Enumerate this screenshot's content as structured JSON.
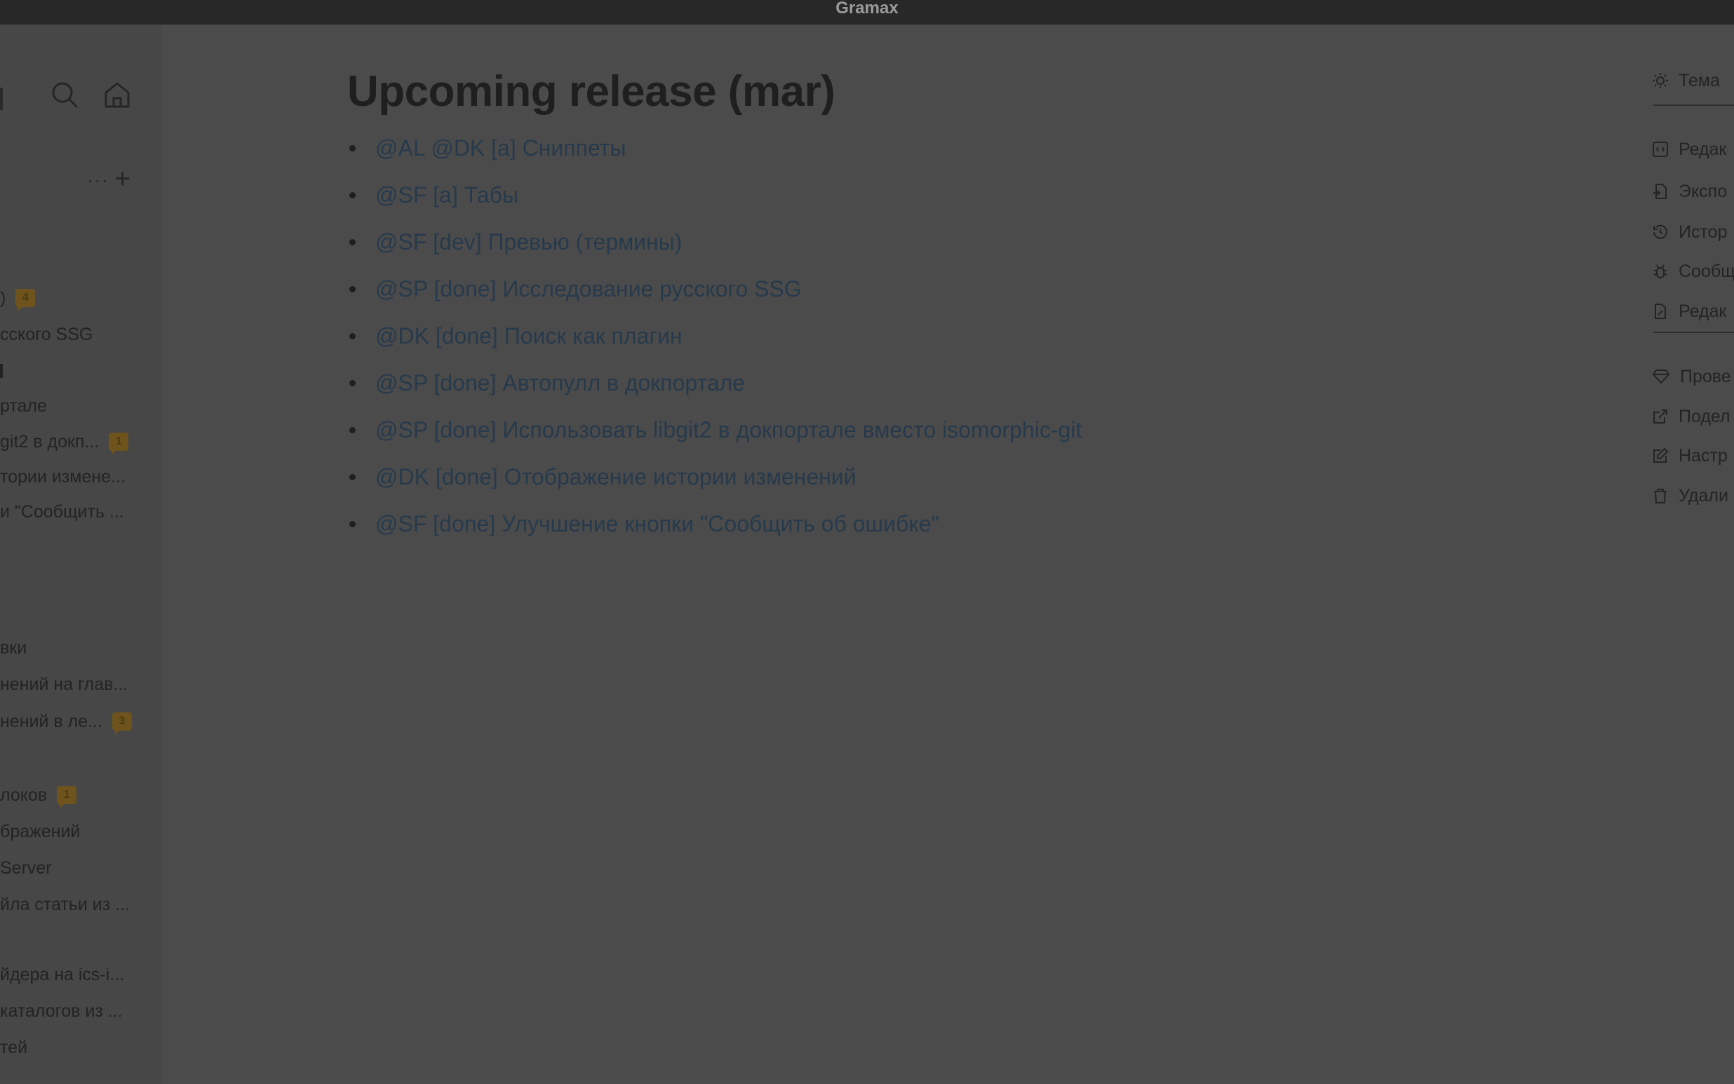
{
  "app": {
    "title": "Gramax"
  },
  "sidebar": {
    "items": [
      {
        "label": ")",
        "badge": "4"
      },
      {
        "label": "сского SSG"
      },
      {
        "label": ""
      },
      {
        "label": "ртале"
      },
      {
        "label": "git2 в докп...",
        "badge": "1"
      },
      {
        "label": "тории измене..."
      },
      {
        "label": "и \"Сообщить ..."
      },
      {
        "label": "вки"
      },
      {
        "label": "нений на глав..."
      },
      {
        "label": "нений в ле...",
        "badge": "3"
      },
      {
        "label": "локов",
        "badge": "1"
      },
      {
        "label": "бражений"
      },
      {
        "label": " Server"
      },
      {
        "label": "йла статьи из ..."
      },
      {
        "label": "йдера на ics-i..."
      },
      {
        "label": "каталогов из ..."
      },
      {
        "label": "тей"
      }
    ]
  },
  "article": {
    "title": "Upcoming release (mar)",
    "items": [
      "@AL @DK [a] Сниппеты",
      "@SF [a] Табы",
      "@SF [dev] Превью (термины)",
      "@SP [done] Исследование русского SSG",
      "@DK [done] Поиск как плагин",
      "@SP [done] Автопулл в докпортале",
      "@SP [done] Использовать libgit2 в докпортале вместо isomorphic-git",
      "@DK [done] Отображение истории изменений",
      "@SF [done] Улучшение кнопки \"Сообщить об ошибке\""
    ]
  },
  "right_panel": {
    "theme": "Тема",
    "actions": [
      "Редак",
      "Экспо",
      "Истор",
      "Сообщ",
      "Редак"
    ],
    "actions2": [
      "Прове",
      "Подел",
      "Настр",
      "Удали"
    ]
  },
  "colors": {
    "overlay_bg": "#4b4b4b",
    "link": "#273a4c",
    "badge": "#6e541c"
  }
}
